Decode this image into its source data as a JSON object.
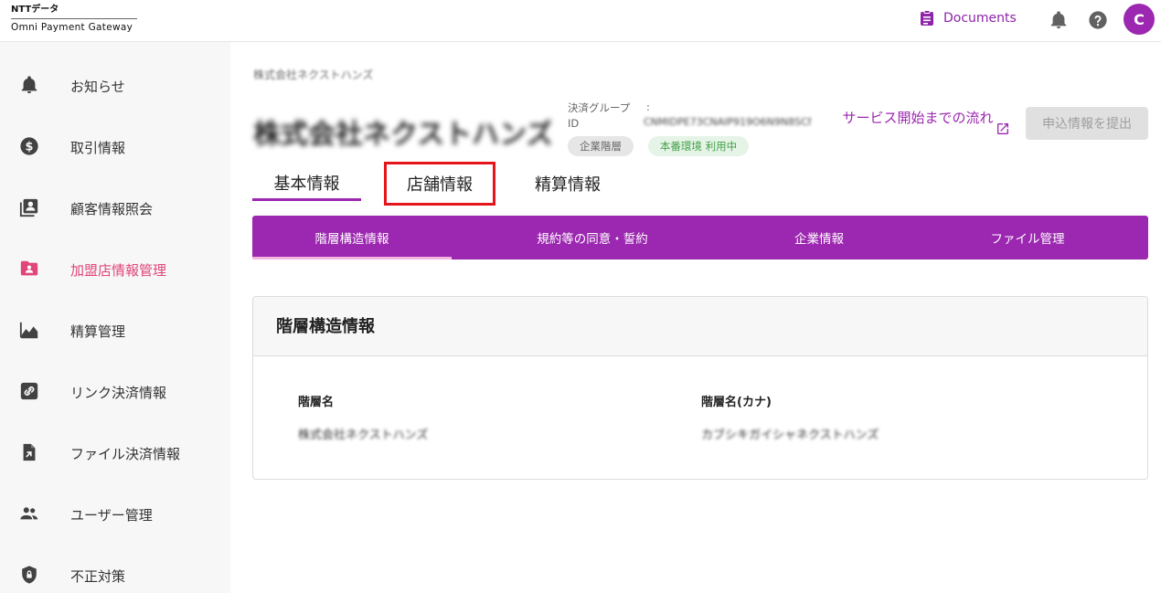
{
  "header": {
    "logo_line1": "NTTデータ",
    "logo_line2": "Omni Payment Gateway",
    "documents_label": "Documents",
    "avatar_initial": "C",
    "accent_color": "#9c27b0"
  },
  "sidebar": {
    "items": [
      {
        "label": "お知らせ",
        "icon": "bell-icon"
      },
      {
        "label": "取引情報",
        "icon": "dollar-circle-icon"
      },
      {
        "label": "顧客情報照会",
        "icon": "contacts-icon"
      },
      {
        "label": "加盟店情報管理",
        "icon": "folder-user-icon",
        "active": true
      },
      {
        "label": "精算管理",
        "icon": "area-chart-icon"
      },
      {
        "label": "リンク決済情報",
        "icon": "link-icon"
      },
      {
        "label": "ファイル決済情報",
        "icon": "file-upload-icon"
      },
      {
        "label": "ユーザー管理",
        "icon": "people-icon"
      },
      {
        "label": "不正対策",
        "icon": "shield-lock-icon"
      }
    ],
    "active_color": "#e0457b"
  },
  "main": {
    "breadcrumb": "株式会社ネクストハンズ",
    "company_name": "株式会社ネクストハンズ",
    "group_label": "決済グループID",
    "group_colon": ":",
    "group_id": "CNMIDPE73CNAIP919O6N9N8SCNX7",
    "chip_level": "企業階層",
    "chip_env": "本番環境 利用中",
    "service_link": "サービス開始までの流れ",
    "submit_button": "申込情報を提出",
    "tabs": [
      {
        "label": "基本情報",
        "active": true
      },
      {
        "label": "店舗情報",
        "highlighted": true
      },
      {
        "label": "精算情報"
      }
    ],
    "subtabs": [
      {
        "label": "階層構造情報",
        "active": true
      },
      {
        "label": "規約等の同意・誓約"
      },
      {
        "label": "企業情報"
      },
      {
        "label": "ファイル管理"
      }
    ],
    "card": {
      "title": "階層構造情報",
      "fields": [
        {
          "label": "階層名",
          "value": "株式会社ネクストハンズ"
        },
        {
          "label": "階層名(カナ)",
          "value": "カブシキガイシャネクストハンズ"
        }
      ]
    }
  }
}
